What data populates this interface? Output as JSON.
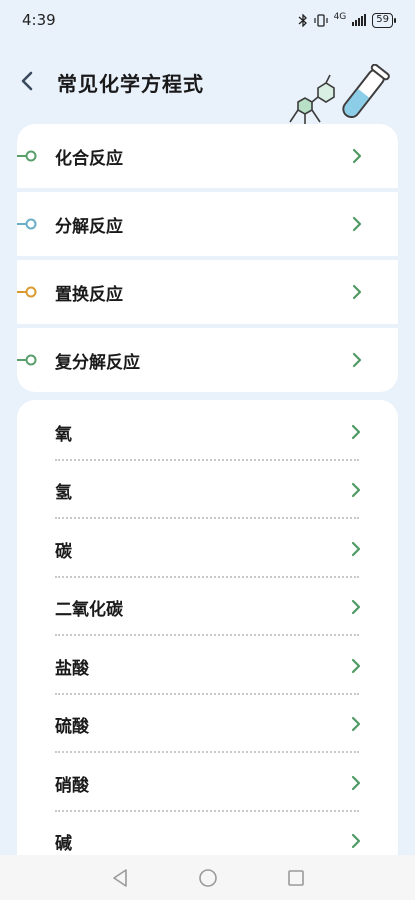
{
  "status": {
    "time": "4:39",
    "network": "4G",
    "battery": "59"
  },
  "header": {
    "title": "常见化学方程式"
  },
  "colors": {
    "green": "#5a9e6b",
    "blue": "#6aaec6",
    "orange": "#d99b2f",
    "chevron": "#4f9a63"
  },
  "categories": [
    {
      "label": "化合反应",
      "color": "green"
    },
    {
      "label": "分解反应",
      "color": "blue"
    },
    {
      "label": "置换反应",
      "color": "orange"
    },
    {
      "label": "复分解反应",
      "color": "green"
    }
  ],
  "substances": [
    "氧",
    "氢",
    "碳",
    "二氧化碳",
    "盐酸",
    "硫酸",
    "硝酸",
    "碱"
  ]
}
